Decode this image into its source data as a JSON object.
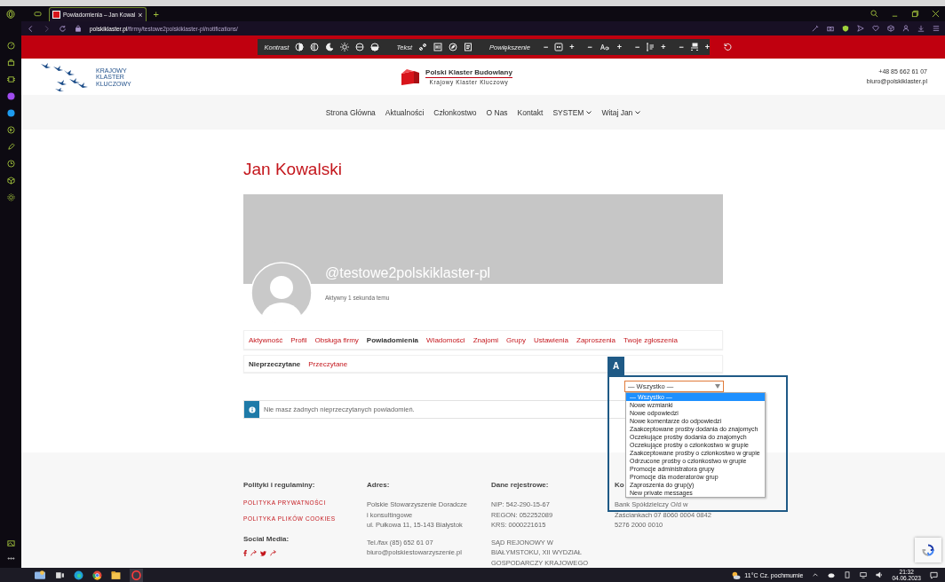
{
  "browser": {
    "tab_title": "Powiadomienia – Jan Kowal",
    "tab_close": "×",
    "new_tab": "+",
    "url_domain": "polskiklaster.pl",
    "url_path": "/firmy/testowe2polskiklaster-pl/notifications/"
  },
  "accessibility_toolbar": {
    "contrast_label": "Kontrast",
    "text_label": "Tekst",
    "zoom_label": "Powiększenie",
    "zoom_controls": [
      {
        "kind": "page",
        "minus": "−",
        "plus": "+"
      },
      {
        "kind": "font",
        "minus": "−",
        "plus": "+"
      },
      {
        "kind": "line-height",
        "minus": "−",
        "plus": "+"
      },
      {
        "kind": "spacing",
        "minus": "−",
        "plus": "+"
      }
    ]
  },
  "header": {
    "left_logo_lines": [
      "KRAJOWY",
      "KLASTER",
      "KLUCZOWY"
    ],
    "brand": "Polski Klaster Budowlany",
    "brand_subtitle": "Krajowy Klaster Kluczowy",
    "phone": "+48 85 662 61 07",
    "email": "biuro@polskiklaster.pl"
  },
  "nav": [
    {
      "label": "Strona Główna",
      "has_dropdown": false
    },
    {
      "label": "Aktualności",
      "has_dropdown": false
    },
    {
      "label": "Członkostwo",
      "has_dropdown": false
    },
    {
      "label": "O Nas",
      "has_dropdown": false
    },
    {
      "label": "Kontakt",
      "has_dropdown": false
    },
    {
      "label": "SYSTEM",
      "has_dropdown": true
    },
    {
      "label": "Witaj Jan",
      "has_dropdown": true
    }
  ],
  "profile": {
    "name": "Jan Kowalski",
    "handle": "@testowe2polskiklaster-pl",
    "last_active": "Aktywny 1 sekunda temu"
  },
  "tabs": [
    {
      "label": "Aktywność",
      "selected": false
    },
    {
      "label": "Profil",
      "selected": false
    },
    {
      "label": "Obsługa firmy",
      "selected": false
    },
    {
      "label": "Powiadomienia",
      "selected": true
    },
    {
      "label": "Wiadomości",
      "selected": false
    },
    {
      "label": "Znajomi",
      "selected": false
    },
    {
      "label": "Grupy",
      "selected": false
    },
    {
      "label": "Ustawienia",
      "selected": false
    },
    {
      "label": "Zaproszenia",
      "selected": false
    },
    {
      "label": "Twoje zgłoszenia",
      "selected": false
    }
  ],
  "subtabs": [
    {
      "label": "Nieprzeczytane",
      "selected": true
    },
    {
      "label": "Przeczytane",
      "selected": false
    }
  ],
  "notice": {
    "text": "Nie masz żadnych nieprzeczytanych powiadomień."
  },
  "annotation": {
    "label": "A"
  },
  "filter": {
    "value": "— Wszystko —",
    "options": [
      {
        "label": "— Wszystko —",
        "selected": true
      },
      {
        "label": "Nowe wzmianki",
        "selected": false
      },
      {
        "label": "Nowe odpowiedzi",
        "selected": false
      },
      {
        "label": "Nowe komentarze do odpowiedzi",
        "selected": false
      },
      {
        "label": "Zaakceptowane prośby dodania do znajomych",
        "selected": false
      },
      {
        "label": "Oczekujące prośby dodania do znajomych",
        "selected": false
      },
      {
        "label": "Oczekujące prośby o członkostwo w grupie",
        "selected": false
      },
      {
        "label": "Zaakceptowane prośby o członkostwo w grupie",
        "selected": false
      },
      {
        "label": "Odrzucone prośby o członkostwo w grupie",
        "selected": false
      },
      {
        "label": "Promocje administratora grupy",
        "selected": false
      },
      {
        "label": "Promocje dla moderatorów grup",
        "selected": false
      },
      {
        "label": "Zaproszenia do grup(y)",
        "selected": false
      },
      {
        "label": "New private messages",
        "selected": false
      }
    ]
  },
  "footer": {
    "policies": {
      "heading": "Polityki i regulaminy:",
      "links": [
        "POLITYKA PRYWATNOŚCI",
        "POLITYKA PLIKÓW COOKIES"
      ],
      "social_heading": "Social Media:"
    },
    "address": {
      "heading": "Adres:",
      "lines": [
        "Polskie Stowarzyszenie Doradcze",
        "i konsultingowe",
        "ul. Pułkowa 11, 15-143 Białystok"
      ],
      "contact_lines": [
        "Tel./fax (85) 652 61 07",
        "biuro@polskiestowarzyszenie.pl"
      ]
    },
    "registry": {
      "heading": "Dane rejestrowe:",
      "lines": [
        "NIP: 542-290-15-67",
        "REGON: 052252089",
        "KRS: 0000221615"
      ],
      "court_lines": [
        "SĄD REJONOWY W",
        "BIAŁYMSTOKU, XII WYDZIAŁ",
        "GOSPODARCZY KRAJOWEGO"
      ]
    },
    "column_4": {
      "heading": "Ko",
      "lines": [
        "Bank Spółdzielczy O/d w",
        "Zaściankach 07 8060 0004 0842",
        "5276 2000 0010"
      ]
    }
  },
  "taskbar": {
    "weather": "11°C Cz. pochmurnie",
    "time": "21:32",
    "date": "04.06.2023"
  }
}
